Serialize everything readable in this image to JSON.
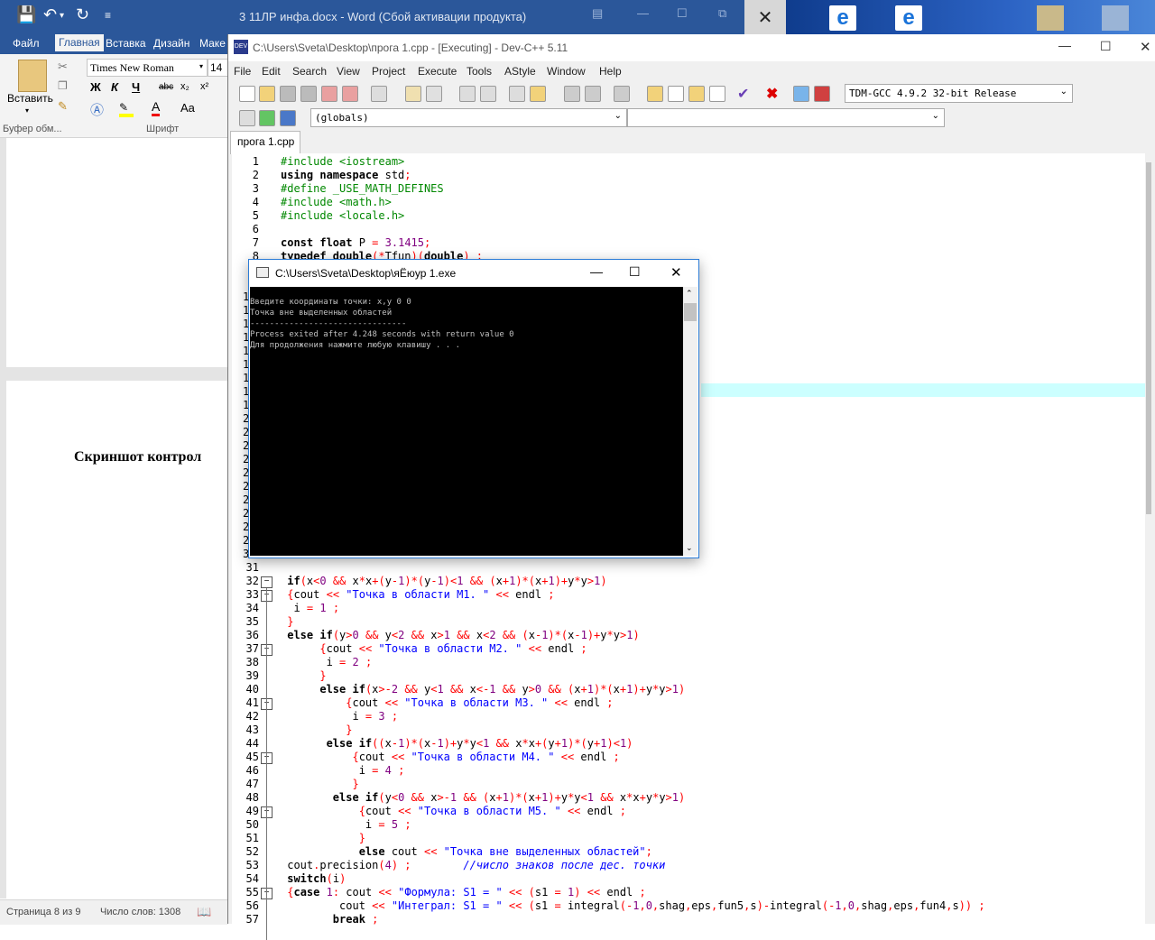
{
  "word": {
    "title": "3 11ЛР инфа.docx - Word (Сбой активации продукта)",
    "tabs": [
      "Файл",
      "Главная",
      "Вставка",
      "Дизайн",
      "Маке"
    ],
    "font_name": "Times New Roman",
    "font_size": "14",
    "paste_label": "Вставить",
    "clipboard_group": "Буфер обм...",
    "font_group": "Шрифт",
    "format_buttons": [
      "Ж",
      "К",
      "Ч",
      "abc",
      "x₂",
      "x²",
      "A",
      "Aa"
    ],
    "doc_heading": "Скриншот контрол",
    "status_page": "Страница 8 из 9",
    "status_words": "Число слов: 1308"
  },
  "devcpp": {
    "title": "C:\\Users\\Sveta\\Desktop\\прога 1.cpp - [Executing] - Dev-C++ 5.11",
    "menu": [
      "File",
      "Edit",
      "Search",
      "View",
      "Project",
      "Execute",
      "Tools",
      "AStyle",
      "Window",
      "Help"
    ],
    "compiler": "TDM-GCC 4.9.2 32-bit Release",
    "scope": "(globals)",
    "file_tab": "прога 1.cpp",
    "top_lines": [
      {
        "n": "1",
        "html": "<span class=\"pp\">#include &lt;iostream&gt;</span>"
      },
      {
        "n": "2",
        "html": "<span class=\"kw\">using namespace</span> std<span class=\"op\">;</span>"
      },
      {
        "n": "3",
        "html": "<span class=\"pp\">#define _USE_MATH_DEFINES</span>"
      },
      {
        "n": "4",
        "html": "<span class=\"pp\">#include &lt;math.h&gt;</span>"
      },
      {
        "n": "5",
        "html": "<span class=\"pp\">#include &lt;locale.h&gt;</span>"
      },
      {
        "n": "6",
        "html": ""
      },
      {
        "n": "7",
        "html": "<span class=\"kw\">const float</span> P <span class=\"op\">=</span> <span class=\"num\">3.1415</span><span class=\"op\">;</span>"
      },
      {
        "n": "8",
        "html": "<span class=\"kw\">typedef double</span><span class=\"op\">(*</span>Tfun<span class=\"op\">)(</span><span class=\"kw\">double</span><span class=\"op\">) ;</span>"
      }
    ],
    "hidden_line_labels": [
      "1",
      "1",
      "1",
      "1",
      "1",
      "1",
      "1",
      "1",
      "1",
      "2",
      "2",
      "2",
      "2",
      "2",
      "2",
      "2",
      "2",
      "2",
      "2",
      "3"
    ],
    "bottom_lines": [
      {
        "n": "31",
        "html": ""
      },
      {
        "n": "32",
        "html": " <span class=\"kw\">if</span><span class=\"op\">(</span>x<span class=\"op\">&lt;</span><span class=\"num\">0</span> <span class=\"op\">&amp;&amp;</span> x<span class=\"op\">*</span>x<span class=\"op\">+(</span>y<span class=\"op\">-</span><span class=\"num\">1</span><span class=\"op\">)*(</span>y<span class=\"op\">-</span><span class=\"num\">1</span><span class=\"op\">)&lt;</span><span class=\"num\">1</span> <span class=\"op\">&amp;&amp; (</span>x<span class=\"op\">+</span><span class=\"num\">1</span><span class=\"op\">)*(</span>x<span class=\"op\">+</span><span class=\"num\">1</span><span class=\"op\">)+</span>y<span class=\"op\">*</span>y<span class=\"op\">&gt;</span><span class=\"num\">1</span><span class=\"op\">)</span>",
        "fold": true
      },
      {
        "n": "33",
        "html": " <span class=\"op\">{</span>cout <span class=\"op\">&lt;&lt;</span> <span class=\"str\">\"Точка в области М1. \"</span> <span class=\"op\">&lt;&lt;</span> endl <span class=\"op\">;</span>",
        "fold": true
      },
      {
        "n": "34",
        "html": "  i <span class=\"op\">=</span> <span class=\"num\">1</span> <span class=\"op\">;</span>"
      },
      {
        "n": "35",
        "html": " <span class=\"op\">}</span>"
      },
      {
        "n": "36",
        "html": " <span class=\"kw\">else if</span><span class=\"op\">(</span>y<span class=\"op\">&gt;</span><span class=\"num\">0</span> <span class=\"op\">&amp;&amp;</span> y<span class=\"op\">&lt;</span><span class=\"num\">2</span> <span class=\"op\">&amp;&amp;</span> x<span class=\"op\">&gt;</span><span class=\"num\">1</span> <span class=\"op\">&amp;&amp;</span> x<span class=\"op\">&lt;</span><span class=\"num\">2</span> <span class=\"op\">&amp;&amp; (</span>x<span class=\"op\">-</span><span class=\"num\">1</span><span class=\"op\">)*(</span>x<span class=\"op\">-</span><span class=\"num\">1</span><span class=\"op\">)+</span>y<span class=\"op\">*</span>y<span class=\"op\">&gt;</span><span class=\"num\">1</span><span class=\"op\">)</span>"
      },
      {
        "n": "37",
        "html": "      <span class=\"op\">{</span>cout <span class=\"op\">&lt;&lt;</span> <span class=\"str\">\"Точка в области М2. \"</span> <span class=\"op\">&lt;&lt;</span> endl <span class=\"op\">;</span>",
        "fold": true
      },
      {
        "n": "38",
        "html": "       i <span class=\"op\">=</span> <span class=\"num\">2</span> <span class=\"op\">;</span>"
      },
      {
        "n": "39",
        "html": "      <span class=\"op\">}</span>"
      },
      {
        "n": "40",
        "html": "      <span class=\"kw\">else if</span><span class=\"op\">(</span>x<span class=\"op\">&gt;-</span><span class=\"num\">2</span> <span class=\"op\">&amp;&amp;</span> y<span class=\"op\">&lt;</span><span class=\"num\">1</span> <span class=\"op\">&amp;&amp;</span> x<span class=\"op\">&lt;-</span><span class=\"num\">1</span> <span class=\"op\">&amp;&amp;</span> y<span class=\"op\">&gt;</span><span class=\"num\">0</span> <span class=\"op\">&amp;&amp; (</span>x<span class=\"op\">+</span><span class=\"num\">1</span><span class=\"op\">)*(</span>x<span class=\"op\">+</span><span class=\"num\">1</span><span class=\"op\">)+</span>y<span class=\"op\">*</span>y<span class=\"op\">&gt;</span><span class=\"num\">1</span><span class=\"op\">)</span>"
      },
      {
        "n": "41",
        "html": "          <span class=\"op\">{</span>cout <span class=\"op\">&lt;&lt;</span> <span class=\"str\">\"Точка в области М3. \"</span> <span class=\"op\">&lt;&lt;</span> endl <span class=\"op\">;</span>",
        "fold": true
      },
      {
        "n": "42",
        "html": "           i <span class=\"op\">=</span> <span class=\"num\">3</span> <span class=\"op\">;</span>"
      },
      {
        "n": "43",
        "html": "          <span class=\"op\">}</span>"
      },
      {
        "n": "44",
        "html": "       <span class=\"kw\">else if</span><span class=\"op\">((</span>x<span class=\"op\">-</span><span class=\"num\">1</span><span class=\"op\">)*(</span>x<span class=\"op\">-</span><span class=\"num\">1</span><span class=\"op\">)+</span>y<span class=\"op\">*</span>y<span class=\"op\">&lt;</span><span class=\"num\">1</span> <span class=\"op\">&amp;&amp;</span> x<span class=\"op\">*</span>x<span class=\"op\">+(</span>y<span class=\"op\">+</span><span class=\"num\">1</span><span class=\"op\">)*(</span>y<span class=\"op\">+</span><span class=\"num\">1</span><span class=\"op\">)&lt;</span><span class=\"num\">1</span><span class=\"op\">)</span>"
      },
      {
        "n": "45",
        "html": "           <span class=\"op\">{</span>cout <span class=\"op\">&lt;&lt;</span> <span class=\"str\">\"Точка в области М4. \"</span> <span class=\"op\">&lt;&lt;</span> endl <span class=\"op\">;</span>",
        "fold": true
      },
      {
        "n": "46",
        "html": "            i <span class=\"op\">=</span> <span class=\"num\">4</span> <span class=\"op\">;</span>"
      },
      {
        "n": "47",
        "html": "           <span class=\"op\">}</span>"
      },
      {
        "n": "48",
        "html": "        <span class=\"kw\">else if</span><span class=\"op\">(</span>y<span class=\"op\">&lt;</span><span class=\"num\">0</span> <span class=\"op\">&amp;&amp;</span> x<span class=\"op\">&gt;-</span><span class=\"num\">1</span> <span class=\"op\">&amp;&amp; (</span>x<span class=\"op\">+</span><span class=\"num\">1</span><span class=\"op\">)*(</span>x<span class=\"op\">+</span><span class=\"num\">1</span><span class=\"op\">)+</span>y<span class=\"op\">*</span>y<span class=\"op\">&lt;</span><span class=\"num\">1</span> <span class=\"op\">&amp;&amp;</span> x<span class=\"op\">*</span>x<span class=\"op\">+</span>y<span class=\"op\">*</span>y<span class=\"op\">&gt;</span><span class=\"num\">1</span><span class=\"op\">)</span>"
      },
      {
        "n": "49",
        "html": "            <span class=\"op\">{</span>cout <span class=\"op\">&lt;&lt;</span> <span class=\"str\">\"Точка в области М5. \"</span> <span class=\"op\">&lt;&lt;</span> endl <span class=\"op\">;</span>",
        "fold": true
      },
      {
        "n": "50",
        "html": "             i <span class=\"op\">=</span> <span class=\"num\">5</span> <span class=\"op\">;</span>"
      },
      {
        "n": "51",
        "html": "            <span class=\"op\">}</span>"
      },
      {
        "n": "52",
        "html": "            <span class=\"kw\">else</span> cout <span class=\"op\">&lt;&lt;</span> <span class=\"str\">\"Точка вне выделенных областей\"</span><span class=\"op\">;</span>"
      },
      {
        "n": "53",
        "html": " cout<span class=\"op\">.</span>precision<span class=\"op\">(</span><span class=\"num\">4</span><span class=\"op\">) ;</span>        <span class=\"cm\">//число знаков после дес. точки</span>"
      },
      {
        "n": "54",
        "html": " <span class=\"kw\">switch</span><span class=\"op\">(</span>i<span class=\"op\">)</span>"
      },
      {
        "n": "55",
        "html": " <span class=\"op\">{</span><span class=\"kw\">case</span> <span class=\"num\">1</span><span class=\"op\">:</span> cout <span class=\"op\">&lt;&lt;</span> <span class=\"str\">\"Формула: S1 = \"</span> <span class=\"op\">&lt;&lt; (</span>s1 <span class=\"op\">=</span> <span class=\"num\">1</span><span class=\"op\">) &lt;&lt;</span> endl <span class=\"op\">;</span>",
        "fold": true
      },
      {
        "n": "56",
        "html": "         cout <span class=\"op\">&lt;&lt;</span> <span class=\"str\">\"Интеграл: S1 = \"</span> <span class=\"op\">&lt;&lt; (</span>s1 <span class=\"op\">=</span> integral<span class=\"op\">(-</span><span class=\"num\">1</span><span class=\"op\">,</span><span class=\"num\">0</span><span class=\"op\">,</span>shag<span class=\"op\">,</span>eps<span class=\"op\">,</span>fun5<span class=\"op\">,</span>s<span class=\"op\">)-</span>integral<span class=\"op\">(-</span><span class=\"num\">1</span><span class=\"op\">,</span><span class=\"num\">0</span><span class=\"op\">,</span>shag<span class=\"op\">,</span>eps<span class=\"op\">,</span>fun4<span class=\"op\">,</span>s<span class=\"op\">)) ;</span>"
      },
      {
        "n": "57",
        "html": "        <span class=\"kw\">break</span> <span class=\"op\">;</span>"
      }
    ]
  },
  "console": {
    "title": "C:\\Users\\Sveta\\Desktop\\яЁюур 1.exe",
    "lines": [
      "Введите координаты точки: x,y 0 0",
      "Точка вне выделенных областей",
      "--------------------------------",
      "Process exited after 4.248 seconds with return value 0",
      "Для продолжения нажмите любую клавишу . . ."
    ]
  },
  "colors": {
    "word_blue": "#2b579a",
    "console_bg": "#000000",
    "keyword": "#000000",
    "string": "#0000ff",
    "operator": "#ff0000",
    "preprocessor": "#008000",
    "highlight_line": "#ccffff"
  }
}
